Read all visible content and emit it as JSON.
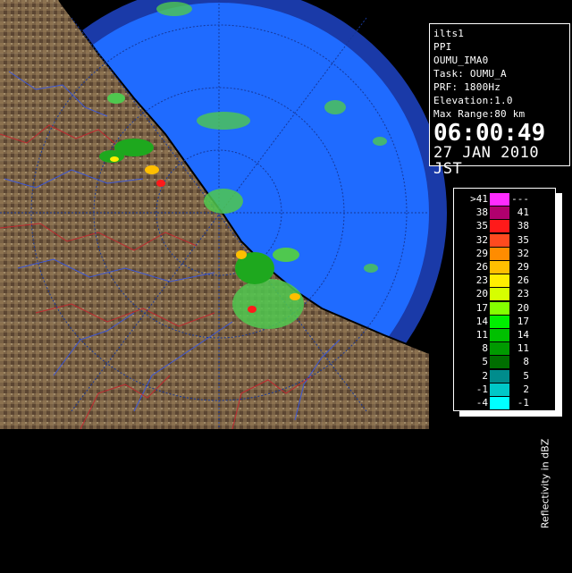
{
  "info": {
    "lines": [
      "ilts1",
      "PPI",
      "OUMU_IMA0",
      "Task: OUMU_A",
      "PRF: 1800Hz",
      "Elevation:1.0",
      "Max Range:80 km"
    ],
    "time": "06:00:49",
    "date": "27 JAN 2010 JST"
  },
  "legend": {
    "title": "Reflectivity in dBZ",
    "rows": [
      {
        "left": ">41",
        "right": "---",
        "color": "#ff2cff"
      },
      {
        "left": "38",
        "right": "41",
        "color": "#b0006e"
      },
      {
        "left": "35",
        "right": "38",
        "color": "#ff1a1a"
      },
      {
        "left": "32",
        "right": "35",
        "color": "#ff4a1f"
      },
      {
        "left": "29",
        "right": "32",
        "color": "#ff8c00"
      },
      {
        "left": "26",
        "right": "29",
        "color": "#ffbf00"
      },
      {
        "left": "23",
        "right": "26",
        "color": "#ffee00"
      },
      {
        "left": "20",
        "right": "23",
        "color": "#d6ff00"
      },
      {
        "left": "17",
        "right": "20",
        "color": "#84ff00"
      },
      {
        "left": "14",
        "right": "17",
        "color": "#00f000"
      },
      {
        "left": "11",
        "right": "14",
        "color": "#00c000"
      },
      {
        "left": "8",
        "right": "11",
        "color": "#009a00"
      },
      {
        "left": "5",
        "right": "8",
        "color": "#006e00"
      },
      {
        "left": "2",
        "right": "5",
        "color": "#008c8c"
      },
      {
        "left": "-1",
        "right": "2",
        "color": "#00c8c8"
      },
      {
        "left": "-4",
        "right": "-1",
        "color": "#00ffff"
      }
    ]
  },
  "map": {
    "colors": {
      "far_ring": "#1a3aa8",
      "range_disc": "#1f6bff",
      "land": "#7a6246",
      "sea": "#000000",
      "coast": "#000000",
      "echo_light": "#4fc84f",
      "echo_mid": "#1ea81e",
      "echo_heavy": "#ff1a1a",
      "range_rings": "#16389a",
      "land_grid": "#9a8a78",
      "rivers": "#3c57d8",
      "borders": "#c0282f"
    }
  }
}
